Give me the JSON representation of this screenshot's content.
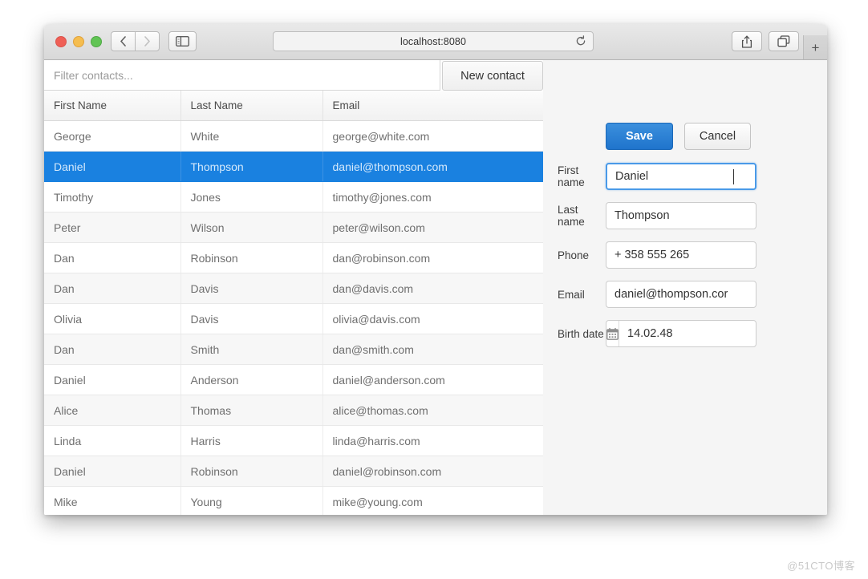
{
  "browser": {
    "address": "localhost:8080",
    "icons": {
      "back": "back-arrow-icon",
      "forward": "forward-arrow-icon",
      "sidebar": "sidebar-toggle-icon",
      "reload": "reload-icon",
      "share": "share-icon",
      "tabs": "tabs-overview-icon",
      "new_tab": "+"
    }
  },
  "app": {
    "filter": {
      "placeholder": "Filter contacts...",
      "value": ""
    },
    "new_contact_label": "New contact",
    "table": {
      "columns": [
        "First Name",
        "Last Name",
        "Email"
      ],
      "rows": [
        {
          "first": "George",
          "last": "White",
          "email": "george@white.com",
          "selected": false
        },
        {
          "first": "Daniel",
          "last": "Thompson",
          "email": "daniel@thompson.com",
          "selected": true
        },
        {
          "first": "Timothy",
          "last": "Jones",
          "email": "timothy@jones.com",
          "selected": false
        },
        {
          "first": "Peter",
          "last": "Wilson",
          "email": "peter@wilson.com",
          "selected": false
        },
        {
          "first": "Dan",
          "last": "Robinson",
          "email": "dan@robinson.com",
          "selected": false
        },
        {
          "first": "Dan",
          "last": "Davis",
          "email": "dan@davis.com",
          "selected": false
        },
        {
          "first": "Olivia",
          "last": "Davis",
          "email": "olivia@davis.com",
          "selected": false
        },
        {
          "first": "Dan",
          "last": "Smith",
          "email": "dan@smith.com",
          "selected": false
        },
        {
          "first": "Daniel",
          "last": "Anderson",
          "email": "daniel@anderson.com",
          "selected": false
        },
        {
          "first": "Alice",
          "last": "Thomas",
          "email": "alice@thomas.com",
          "selected": false
        },
        {
          "first": "Linda",
          "last": "Harris",
          "email": "linda@harris.com",
          "selected": false
        },
        {
          "first": "Daniel",
          "last": "Robinson",
          "email": "daniel@robinson.com",
          "selected": false
        },
        {
          "first": "Mike",
          "last": "Young",
          "email": "mike@young.com",
          "selected": false
        }
      ]
    },
    "form": {
      "save_label": "Save",
      "cancel_label": "Cancel",
      "fields": {
        "first_name": {
          "label": "First name",
          "value": "Daniel"
        },
        "last_name": {
          "label": "Last name",
          "value": "Thompson"
        },
        "phone": {
          "label": "Phone",
          "value": "+ 358 555 265"
        },
        "email": {
          "label": "Email",
          "value": "daniel@thompson.cor"
        },
        "birth_date": {
          "label": "Birth date",
          "value": "14.02.48",
          "icon": "calendar-icon"
        }
      }
    }
  },
  "watermark": "@51CTO博客",
  "colors": {
    "accent_blue": "#1a81e0",
    "save_blue": "#2a7fd4",
    "focus_blue": "#4a9ae8"
  }
}
